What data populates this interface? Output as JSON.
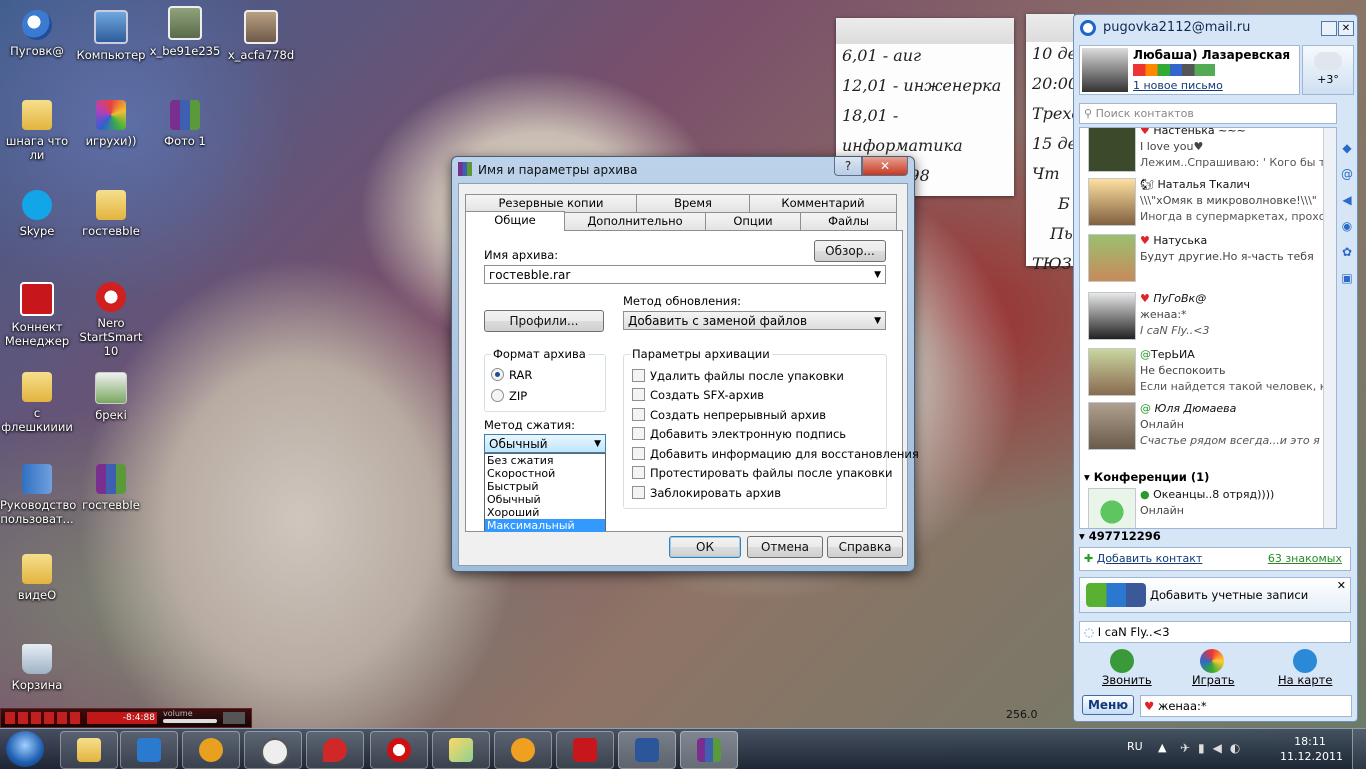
{
  "desktop": {
    "icons": [
      {
        "label": "Пуговк@",
        "icon": "agent-shortcut-icon"
      },
      {
        "label": "Компьютер",
        "icon": "computer-icon"
      },
      {
        "label": "x_be91e235",
        "icon": "photo-icon"
      },
      {
        "label": "x_acfa778d",
        "icon": "photo-icon"
      },
      {
        "label": "шнага что ли",
        "icon": "folder-icon"
      },
      {
        "label": "игрухи))",
        "icon": "games-icon"
      },
      {
        "label": "Фото 1",
        "icon": "winrar-archive-icon"
      },
      {
        "label": "Skype",
        "icon": "skype-icon"
      },
      {
        "label": "гостевbIe",
        "icon": "folder-icon"
      },
      {
        "label": "Коннект Менеджер",
        "icon": "connect-manager-icon"
      },
      {
        "label": "Nero StartSmart 10",
        "icon": "nero-icon"
      },
      {
        "label": "с флешкииии",
        "icon": "folder-icon"
      },
      {
        "label": "брекі",
        "icon": "image-icon"
      },
      {
        "label": "Руководство пользоват...",
        "icon": "manual-icon"
      },
      {
        "label": "гостевbIe",
        "icon": "winrar-archive-icon"
      },
      {
        "label": "видеO",
        "icon": "folder-icon"
      },
      {
        "label": "Корзина",
        "icon": "recycle-bin-icon"
      }
    ]
  },
  "notes": {
    "note1": [
      "6,01 - aиг",
      "12,01 - инженерка",
      "18,01 -",
      "информатика",
      "+98"
    ],
    "note2": [
      "10 де",
      "20:00",
      "Трехо",
      "15 де",
      "Чт",
      "Б",
      "Пь",
      "ТЮЗ"
    ]
  },
  "dialog": {
    "title": "Имя и параметры архива",
    "help_glyph": "?",
    "close_glyph": "✕",
    "tabs_row1": [
      "Резервные копии",
      "Время",
      "Комментарий"
    ],
    "tabs_row2": [
      "Общие",
      "Дополнительно",
      "Опции",
      "Файлы"
    ],
    "archive_name_label": "Имя архива:",
    "archive_name_value": "гостевbIe.rar",
    "browse_button": "Обзор...",
    "update_method_label": "Метод обновления:",
    "update_method_value": "Добавить с заменой файлов",
    "profiles_button": "Профили...",
    "format_group": "Формат архива",
    "format_options": [
      "RAR",
      "ZIP"
    ],
    "format_selected": "RAR",
    "params_group": "Параметры архивации",
    "params": [
      "Удалить файлы после упаковки",
      "Создать SFX-архив",
      "Создать непрерывный архив",
      "Добавить электронную подпись",
      "Добавить информацию для восстановления",
      "Протестировать файлы после упаковки",
      "Заблокировать архив"
    ],
    "compression_label": "Метод сжатия:",
    "compression_value": "Обычный",
    "compression_options": [
      "Без сжатия",
      "Скоростной",
      "Быстрый",
      "Обычный",
      "Хороший",
      "Максимальный"
    ],
    "compression_highlighted": "Максимальный",
    "ok": "ОК",
    "cancel": "Отмена",
    "help": "Справка"
  },
  "agent": {
    "title": "pugovka2112@mail.ru",
    "user_name": "Любаша) Лазаревская",
    "new_mail": "1 новое письмо",
    "weather": "+3°",
    "search_placeholder": "Поиск контактов",
    "contacts": [
      {
        "name": "Настенька ~~~",
        "line1": "I love you♥",
        "line2": "Лежим..Спрашиваю: ' Кого бы ты :"
      },
      {
        "name": "Наталья Ткалич",
        "line1": "\\\\\\\"хОмяк в микроволновке!\\\\\\\"",
        "line2": "Иногда в супермаркетах, проходи"
      },
      {
        "name": "Натуська",
        "line1": "Будут другие.Но я-часть тебя",
        "line2": ""
      },
      {
        "name": "ПуГоВк@",
        "line1": "женаа:*",
        "line2": "I caN Fly..<3"
      },
      {
        "name": "ТерЬИА",
        "line1": "Не беспокоить",
        "line2": "Если найдется такой человек, кото"
      },
      {
        "name": "Юля Дюмаева",
        "line1": "Онлайн",
        "line2": "Счастье рядом всегда...и это я ;)"
      }
    ],
    "conferences_header": "Конференции (1)",
    "conference": {
      "name": "Океанцы..8 отряд))))",
      "status": "Онлайн"
    },
    "group_number": "497712296",
    "add_contact": "Добавить контакт",
    "acquaintances": "63 знакомых",
    "add_accounts": "Добавить учетные записи",
    "status_message": "I caN Fly..<3",
    "actions": [
      "Звонить",
      "Играть",
      "На карте"
    ],
    "menu_button": "Меню",
    "bottom_status": "женаа:*"
  },
  "media_player": {
    "time": "-8:4:88",
    "volume_label": "volume"
  },
  "misc": {
    "side_value": "256.0"
  },
  "taskbar": {
    "apps": [
      "explorer",
      "media-center",
      "aimp",
      "clock",
      "pin",
      "opera",
      "notes",
      "mail-agent",
      "connect-manager",
      "word",
      "winrar"
    ],
    "lang": "RU",
    "time": "18:11",
    "date": "11.12.2011"
  }
}
